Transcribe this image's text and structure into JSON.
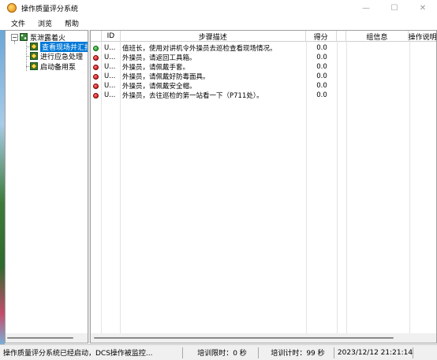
{
  "window": {
    "title": "操作质量评分系统",
    "minimize_glyph": "—",
    "maximize_glyph": "☐",
    "close_glyph": "✕"
  },
  "menu": [
    "文件",
    "浏览",
    "帮助"
  ],
  "tree": {
    "root": {
      "label": "泵泄露着火",
      "expander": "−",
      "icon": "process-icon"
    },
    "children": [
      {
        "label": "查看现场并汇报信",
        "icon": "step-icon",
        "selected": true
      },
      {
        "label": "进行应急处理",
        "icon": "step-icon",
        "selected": false
      },
      {
        "label": "启动备用泵",
        "icon": "step-icon",
        "selected": false
      }
    ]
  },
  "grid": {
    "columns": [
      "",
      "ID",
      "步骤描述",
      "得分",
      "",
      "组信息",
      "操作说明"
    ],
    "rows": [
      {
        "status": "green",
        "id": "U...",
        "description": "值班长，使用对讲机令外操员去巡检查看现场情况。",
        "score": "0.0"
      },
      {
        "status": "red",
        "id": "U...",
        "description": "外操员，请返回工具箱。",
        "score": "0.0"
      },
      {
        "status": "red",
        "id": "U...",
        "description": "外操员，请佩戴手套。",
        "score": "0.0"
      },
      {
        "status": "red",
        "id": "U...",
        "description": "外操员，请佩戴好防毒面具。",
        "score": "0.0"
      },
      {
        "status": "red",
        "id": "U...",
        "description": "外操员，请佩戴安全帽。",
        "score": "0.0"
      },
      {
        "status": "red",
        "id": "U...",
        "description": "外操员，去往巡检的第一站看一下（P711处）。",
        "score": "0.0"
      }
    ]
  },
  "status": {
    "message": "操作质量评分系统已经启动，DCS操作被监控...",
    "training_limit": "培训限时：0 秒",
    "training_timer": "培训计时：99 秒",
    "datetime": "2023/12/12 21:21:14"
  },
  "colors": {
    "status_green": "#15901a",
    "status_red": "#c00000",
    "selection": "#0078d7"
  }
}
